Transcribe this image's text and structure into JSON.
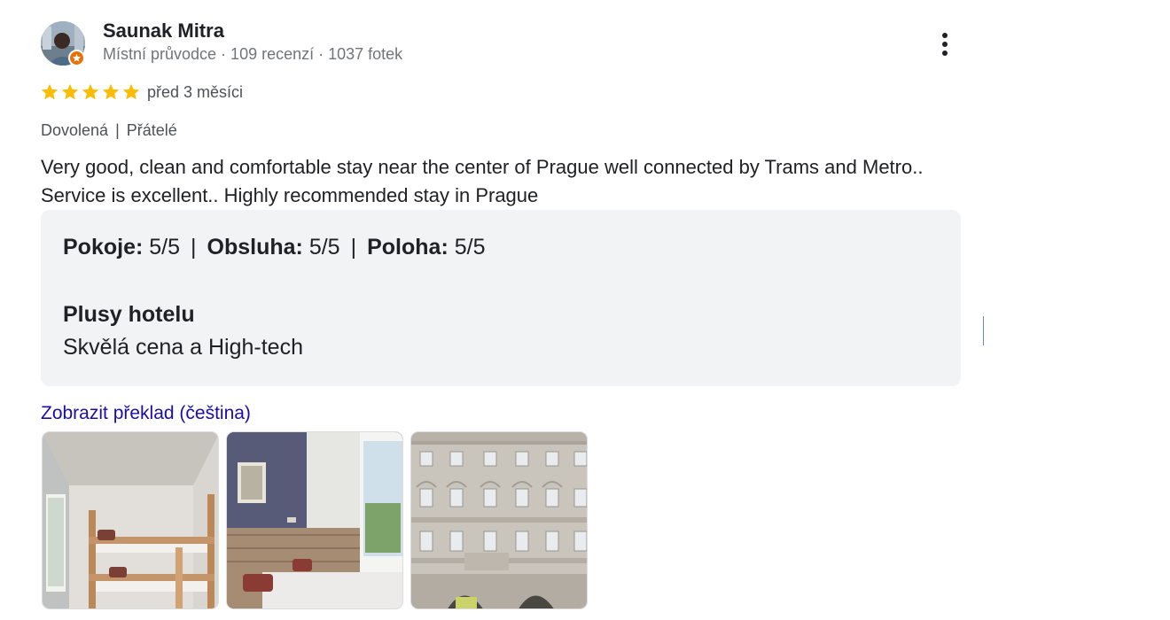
{
  "reviewer": {
    "name": "Saunak Mitra",
    "meta": "Místní průvodce · 109 recenzí · 1037 fotek",
    "avatar_icon": "profile-photo",
    "badge_icon": "local-guide-star-icon",
    "badge_color": "#e8710a"
  },
  "review": {
    "stars": 5,
    "star_color": "#fbbc04",
    "date": "před 3 měsíci",
    "tags": [
      "Dovolená",
      "Přátelé"
    ],
    "tag_separator": "|",
    "text_lines": [
      "Very good, clean and comfortable stay near the center of Prague well connected by Trams and Metro..",
      "Service is excellent.. Highly recommended stay in Prague"
    ]
  },
  "ratings": [
    {
      "label": "Pokoje",
      "value": "5/5"
    },
    {
      "label": "Obsluha",
      "value": "5/5"
    },
    {
      "label": "Poloha",
      "value": "5/5"
    }
  ],
  "ratings_separator": "|",
  "pros": {
    "heading": "Plusy hotelu",
    "text": "Skvělá cena a High-tech"
  },
  "translate_link": "Zobrazit překlad (čeština)",
  "link_color": "#1a0dab",
  "photos": [
    {
      "subject": "room-with-bunk-bed"
    },
    {
      "subject": "room-with-bed-and-window"
    },
    {
      "subject": "building-facade"
    }
  ]
}
